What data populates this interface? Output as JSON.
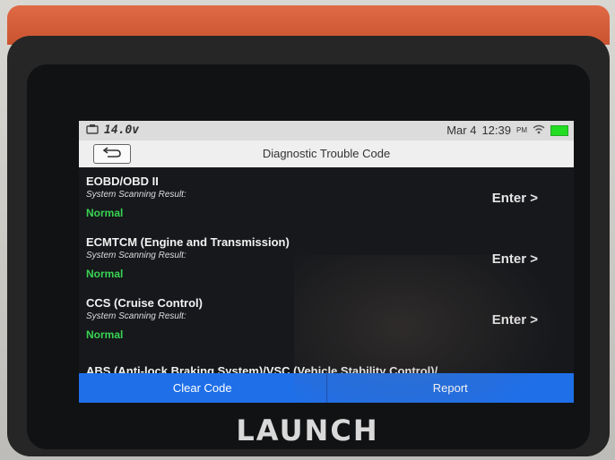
{
  "status_bar": {
    "voltage": "14.0v",
    "date": "Mar 4",
    "time": "12:39",
    "period": "PM"
  },
  "header": {
    "back_label": "",
    "title": "Diagnostic Trouble Code"
  },
  "systems": [
    {
      "name": "EOBD/OBD II",
      "subtitle": "System Scanning Result:",
      "status": "Normal",
      "action": "Enter >"
    },
    {
      "name": "ECMTCM (Engine and Transmission)",
      "subtitle": "System Scanning Result:",
      "status": "Normal",
      "action": "Enter >"
    },
    {
      "name": "CCS (Cruise Control)",
      "subtitle": "System Scanning Result:",
      "status": "Normal",
      "action": "Enter >"
    },
    {
      "name": "ABS (Anti-lock Braking System)/VSC (Vehicle Stability Control)/",
      "subtitle": "",
      "status": "",
      "action": ""
    }
  ],
  "footer": {
    "clear_label": "Clear Code",
    "report_label": "Report"
  },
  "device": {
    "brand": "LAUNCH"
  },
  "colors": {
    "accent": "#1f6fe8",
    "status_ok": "#39d353",
    "case": "#d85f3c"
  }
}
